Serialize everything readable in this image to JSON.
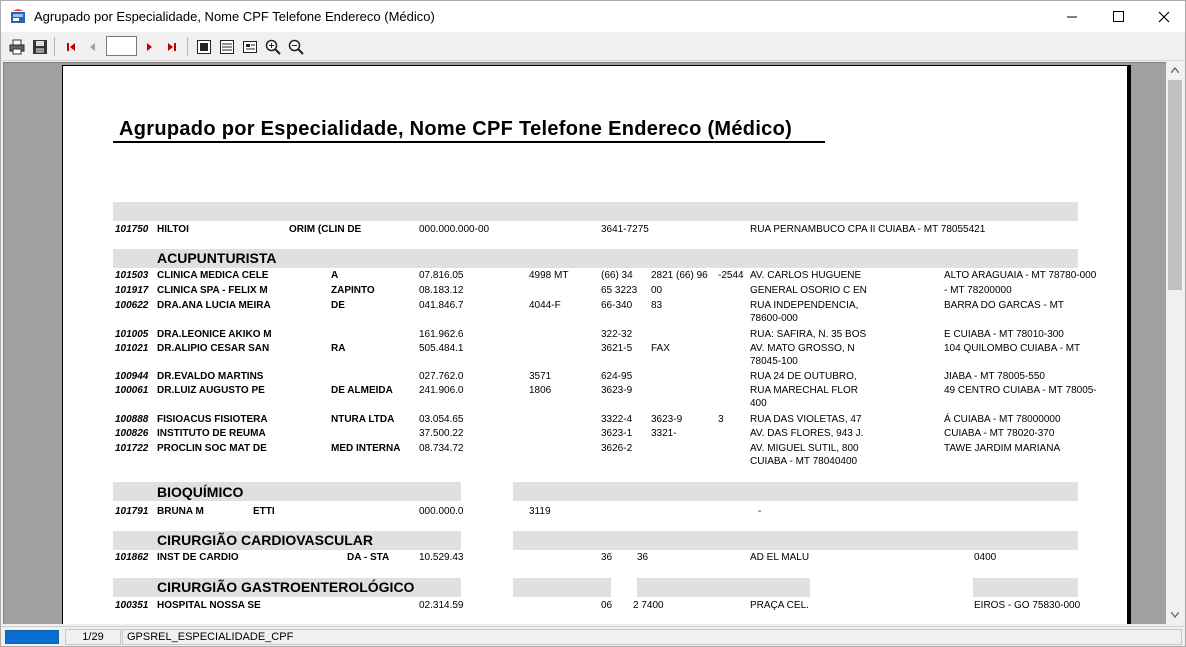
{
  "window": {
    "title": "Agrupado por Especialidade, Nome CPF Telefone Endereco (Médico)"
  },
  "toolbar": {
    "page_value": ""
  },
  "status": {
    "page_indicator": "1/29",
    "report_name": "GPSREL_ESPECIALIDADE_CPF"
  },
  "report": {
    "title": "Agrupado por Especialidade, Nome CPF Telefone Endereco (Médico)",
    "header_row": {
      "code": "101750",
      "name": "HILTOI",
      "name2": "ORIM (CLIN DE",
      "cpf": "000.000.000-00",
      "phone": "3641-7275",
      "addr": "RUA PERNAMBUCO CPA II CUIABA - MT 78055421"
    },
    "groups": [
      {
        "title": "ACUPUNTURISTA",
        "rows": [
          {
            "code": "101503",
            "name": "CLINICA MEDICA CELE",
            "name2": "A",
            "cpf": "07.816.05",
            "crm": "4998 MT",
            "phone": "(66) 34",
            "phone2": "2821 (66) 96",
            "phone3": "-2544",
            "addr": "AV. CARLOS HUGUENE",
            "addr2": "ALTO ARAGUAIA - MT 78780-000"
          },
          {
            "code": "101917",
            "name": "CLINICA SPA - FELIX M",
            "name2": "ZAPINTO",
            "cpf": "08.183.12",
            "crm": "",
            "phone": "65 3223",
            "phone2": "00",
            "phone3": "",
            "addr": "GENERAL OSORIO C EN",
            "addr2": "- MT 78200000"
          },
          {
            "code": "100622",
            "name": "DRA.ANA LUCIA MEIRA",
            "name2": "DE",
            "cpf": "041.846.7",
            "crm": "4044-F",
            "phone": "66-340",
            "phone2": "83",
            "phone3": "",
            "addr": "RUA INDEPENDENCIA,",
            "addr2": "BARRA DO GARCAS - MT",
            "addr3": "78600-000"
          },
          {
            "code": "101005",
            "name": "DRA.LEONICE AKIKO M",
            "name2": "",
            "cpf": "161.962.6",
            "crm": "",
            "phone": "322-32",
            "phone2": "",
            "phone3": "",
            "addr": "RUA: SAFIRA, N. 35 BOS",
            "addr2": "E CUIABA - MT 78010-300"
          },
          {
            "code": "101021",
            "name": "DR.ALIPIO CESAR SAN",
            "name2": "RA",
            "cpf": "505.484.1",
            "crm": "",
            "phone": "3621-5",
            "phone2": "FAX",
            "phone3": "",
            "addr": "AV. MATO GROSSO, N",
            "addr2": "104 QUILOMBO CUIABA - MT",
            "addr3": "78045-100"
          },
          {
            "code": "100944",
            "name": "DR.EVALDO MARTINS",
            "name2": "",
            "cpf": "027.762.0",
            "crm": "3571",
            "phone": "624-95",
            "phone2": "",
            "phone3": "",
            "addr": "RUA 24 DE OUTUBRO,",
            "addr2": "JIABA - MT 78005-550"
          },
          {
            "code": "100061",
            "name": "DR.LUIZ AUGUSTO PE",
            "name2": "DE ALMEIDA",
            "cpf": "241.906.0",
            "crm": "1806",
            "phone": "3623-9",
            "phone2": "",
            "phone3": "",
            "addr": "RUA MARECHAL FLOR",
            "addr2": "49 CENTRO CUIABA - MT 78005-",
            "addr3": "400"
          },
          {
            "code": "100888",
            "name": "FISIOACUS FISIOTERA",
            "name2": "NTURA LTDA",
            "cpf": "03.054.65",
            "crm": "",
            "phone": "3322-4",
            "phone2": "3623-9",
            "phone3": "3",
            "addr": "RUA DAS VIOLETAS, 47",
            "addr2": "Á CUIABA - MT 78000000"
          },
          {
            "code": "100826",
            "name": "INSTITUTO DE REUMA",
            "name2": "",
            "cpf": "37.500.22",
            "crm": "",
            "phone": "3623-1",
            "phone2": "3321-",
            "phone3": "",
            "addr": "AV. DAS FLORES, 943 J.",
            "addr2": "CUIABA - MT 78020-370"
          },
          {
            "code": "101722",
            "name": "PROCLIN SOC MAT DE",
            "name2": "MED INTERNA",
            "cpf": "08.734.72",
            "crm": "",
            "phone": "3626-2",
            "phone2": "",
            "phone3": "",
            "addr": "AV. MIGUEL SUTIL, 800",
            "addr2": "TAWE JARDIM MARIANA",
            "addr3": "CUIABA - MT 78040400"
          }
        ]
      },
      {
        "title": "BIOQUÍMICO",
        "rows": [
          {
            "code": "101791",
            "name": "BRUNA M",
            "name2": "ETTI",
            "cpf": "000.000.0",
            "crm": "3119",
            "phone": "",
            "addr": "-"
          }
        ]
      },
      {
        "title": "CIRURGIÃO CARDIOVASCULAR",
        "rows": [
          {
            "code": "101862",
            "name": "INST DE CARDIO",
            "name2": "DA - STA",
            "cpf": "10.529.43",
            "crm": "",
            "phone": "36",
            "phone2": "36",
            "addr": "AD EL MALU",
            "addr2": "0400"
          }
        ]
      },
      {
        "title": "CIRURGIÃO GASTROENTEROLÓGICO",
        "rows": [
          {
            "code": "100351",
            "name": "HOSPITAL NOSSA SE",
            "name2": "",
            "cpf": "02.314.59",
            "crm": "",
            "phone": "06",
            "phone2": "2 7400",
            "addr": "PRAÇA CEL.",
            "addr2": "EIROS - GO 75830-000"
          }
        ]
      }
    ]
  },
  "icons": {
    "print": "printer-icon",
    "save": "floppy-disk-icon",
    "first": "first-page-icon",
    "prev": "previous-page-icon",
    "next": "next-page-icon",
    "last": "last-page-icon",
    "zoom_in": "zoom-in-icon",
    "zoom_out": "zoom-out-icon"
  },
  "colors": {
    "band": "#e0e0e0",
    "progress": "#0a6ed1",
    "nav_arrow": "#c00000"
  }
}
